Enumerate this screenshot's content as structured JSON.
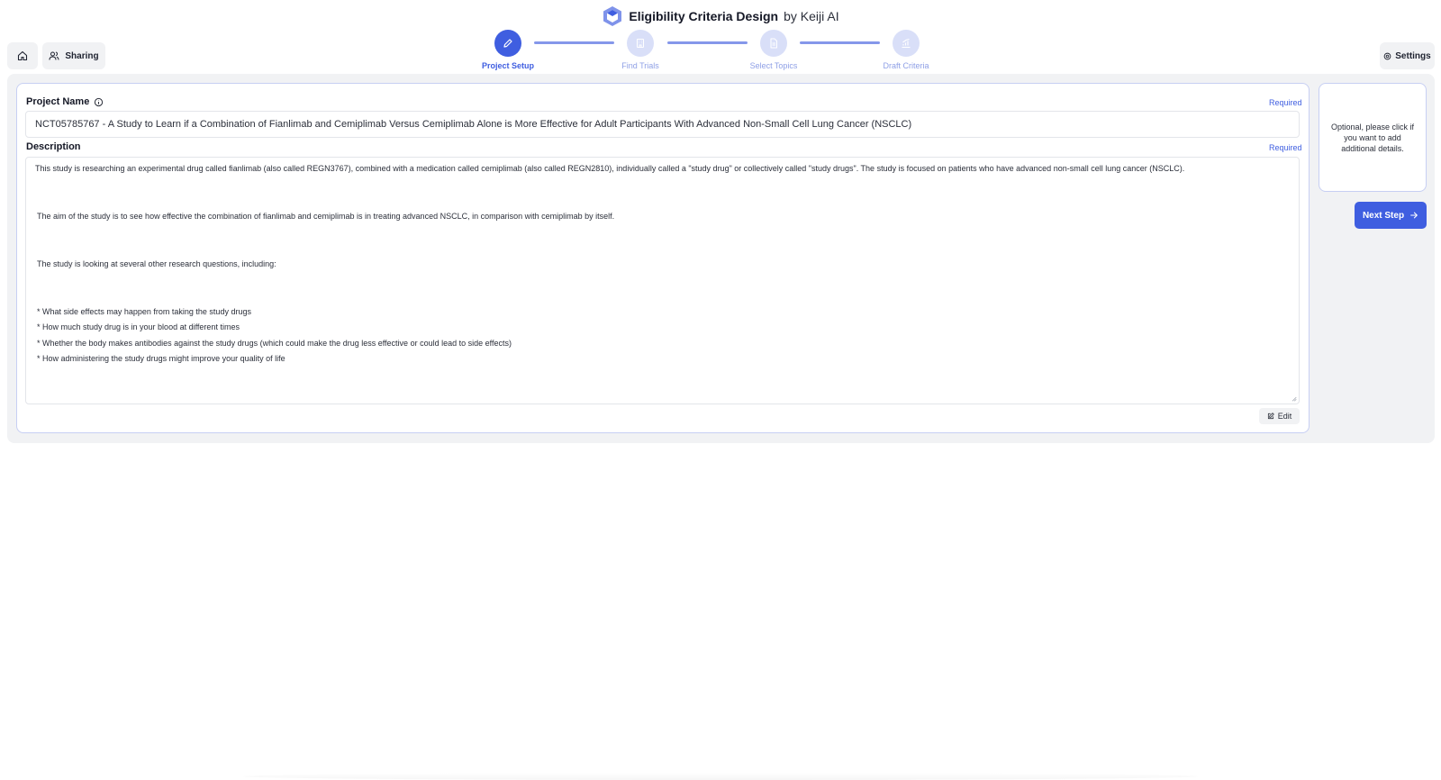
{
  "header": {
    "title": "Eligibility Criteria Design",
    "subtitle": "by Keiji AI",
    "logo_icon": "hexagon-logo-icon",
    "accent_color": "#3f5ee0"
  },
  "toolbar": {
    "home_icon": "home-icon",
    "sharing_label": "Sharing",
    "settings_label": "Settings"
  },
  "stepper": {
    "steps": [
      {
        "label": "Project Setup",
        "icon": "pencil-icon",
        "state": "active"
      },
      {
        "label": "Find Trials",
        "icon": "building-icon",
        "state": "inactive"
      },
      {
        "label": "Select Topics",
        "icon": "document-icon",
        "state": "inactive"
      },
      {
        "label": "Draft Criteria",
        "icon": "chart-icon",
        "state": "inactive"
      }
    ]
  },
  "form": {
    "project_name_label": "Project Name",
    "project_name_required": "Required",
    "project_name_value": "NCT05785767 - A Study to Learn if a Combination of Fianlimab and Cemiplimab Versus Cemiplimab Alone is More Effective for Adult Participants With Advanced Non-Small Cell Lung Cancer (NSCLC)",
    "description_label": "Description",
    "description_required": "Required",
    "description_lines": [
      "This study is researching an experimental drug called fianlimab (also called REGN3767), combined with a medication called cemiplimab (also called REGN2810), individually called a \"study drug\" or collectively called \"study drugs\". The study is focused on patients who have advanced non-small cell lung cancer (NSCLC).",
      "The aim of the study is to see how effective the combination of fianlimab and cemiplimab is in treating advanced NSCLC, in comparison with cemiplimab by itself.",
      "The study is looking at several other research questions, including:",
      "* What side effects may happen from taking the study drugs",
      "* How much study drug is in your blood at different times",
      "* Whether the body makes antibodies against the study drugs (which could make the drug less effective or could lead to side effects)",
      "* How administering the study drugs might improve your quality of life"
    ],
    "edit_label": "Edit"
  },
  "sidebar": {
    "optional_text": "Optional, please click if you want to add additional details.",
    "next_label": "Next Step"
  }
}
